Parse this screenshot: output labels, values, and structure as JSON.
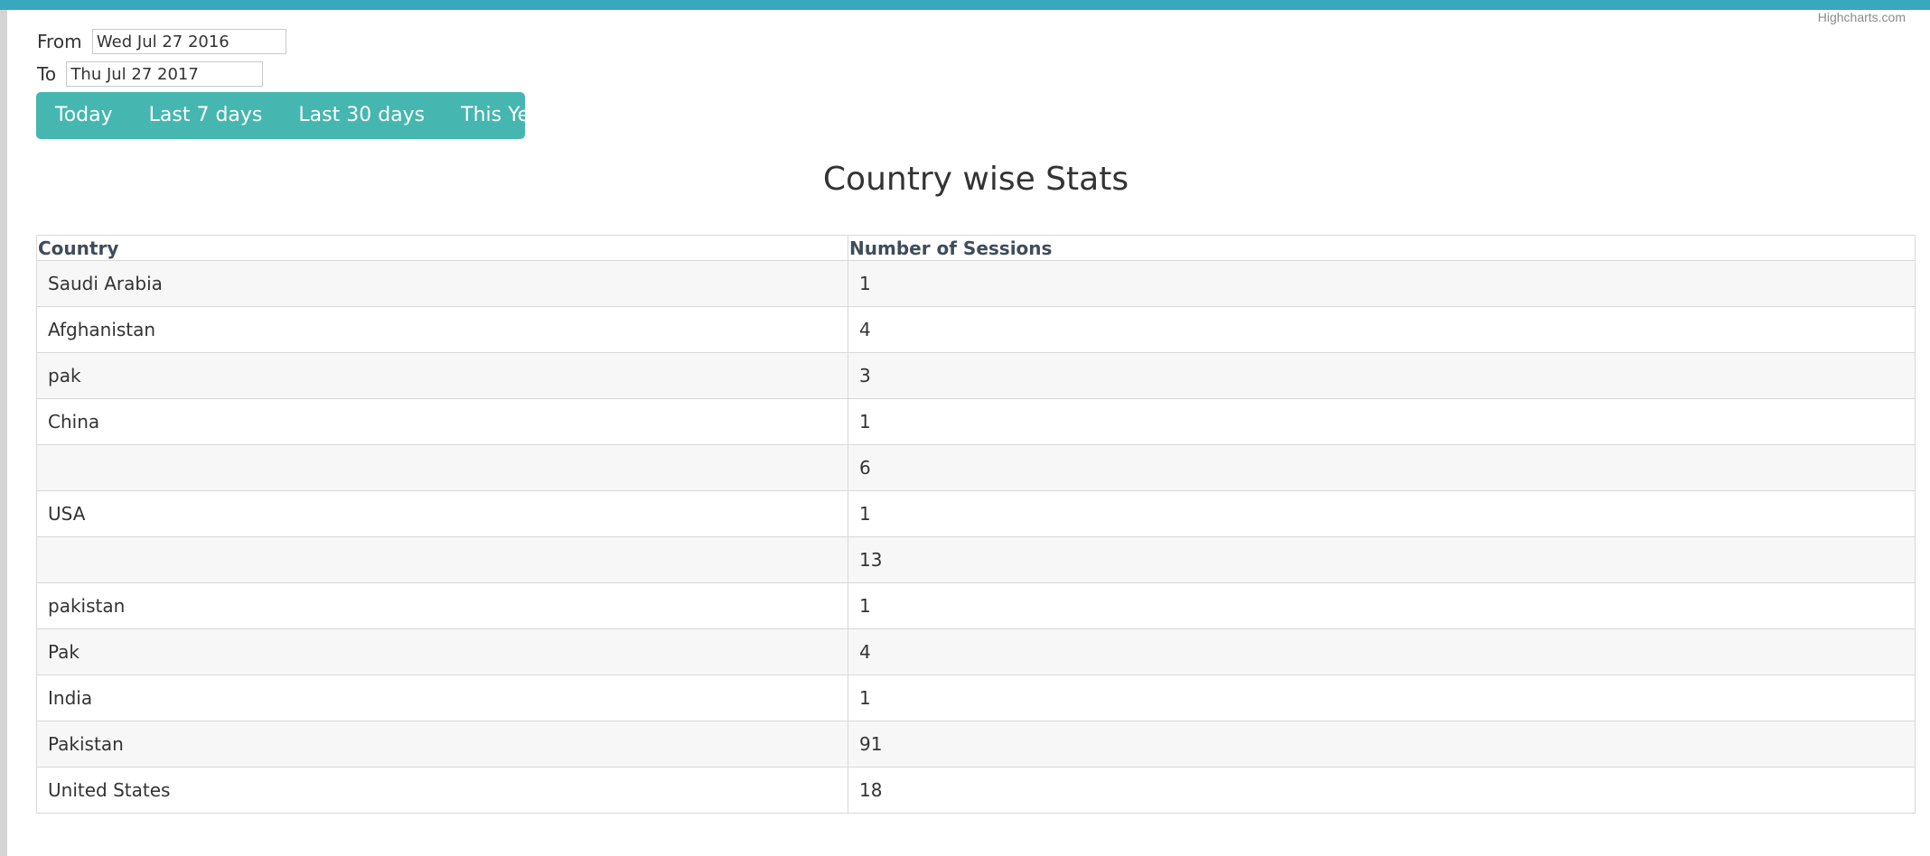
{
  "credit": "Highcharts.com",
  "filters": {
    "from_label": "From",
    "from_value": "Wed Jul 27 2016",
    "to_label": "To",
    "to_value": "Thu Jul 27 2017"
  },
  "range_buttons": [
    "Today",
    "Last 7 days",
    "Last 30 days",
    "This Year"
  ],
  "title": "Country wise Stats",
  "table": {
    "headers": [
      "Country",
      "Number of Sessions"
    ],
    "rows": [
      [
        "Saudi Arabia",
        "1"
      ],
      [
        "Afghanistan",
        "4"
      ],
      [
        "pak",
        "3"
      ],
      [
        "China",
        "1"
      ],
      [
        "",
        "6"
      ],
      [
        "USA",
        "1"
      ],
      [
        "",
        "13"
      ],
      [
        "pakistan",
        "1"
      ],
      [
        "Pak",
        "4"
      ],
      [
        "India",
        "1"
      ],
      [
        "Pakistan",
        "91"
      ],
      [
        "United States",
        "18"
      ]
    ]
  },
  "colors": {
    "topbar": "#37a8bd",
    "button_group": "#45b6b0",
    "row_stripe": "#f7f7f7"
  }
}
